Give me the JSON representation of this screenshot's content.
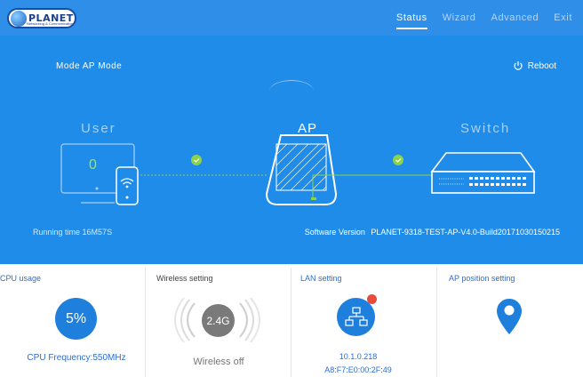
{
  "header": {
    "brand": "PLANET",
    "tagline": "Networking & Communication",
    "nav": [
      {
        "label": "Status",
        "active": true
      },
      {
        "label": "Wizard",
        "active": false
      },
      {
        "label": "Advanced",
        "active": false
      },
      {
        "label": "Exit",
        "active": false
      }
    ]
  },
  "status": {
    "mode_label": "Mode",
    "mode_value": "AP Mode",
    "reboot_label": "Reboot",
    "user_label": "User",
    "ap_label": "AP",
    "switch_label": "Switch",
    "user_count": "0",
    "running_time_label": "Running time",
    "running_time_value": "16M57S",
    "software_version_label": "Software Version",
    "software_version_value": "PLANET-9318-TEST-AP-V4.0-Build20171030150215"
  },
  "panels": {
    "cpu": {
      "title": "CPU usage",
      "usage": "5%",
      "frequency": "CPU Frequency:550MHz"
    },
    "wireless": {
      "title": "Wireless setting",
      "band": "2.4G",
      "state": "Wireless off"
    },
    "lan": {
      "title": "LAN setting",
      "ip": "10.1.0.218",
      "mac": "A8:F7:E0:00:2F:49"
    },
    "position": {
      "title": "AP position setting"
    }
  },
  "colors": {
    "nav_bg": "#2e8ee8",
    "main_bg": "#1e8ce8",
    "status_dot": "#8bd34a",
    "alert": "#e94b36",
    "accent": "#1f7fdc"
  }
}
